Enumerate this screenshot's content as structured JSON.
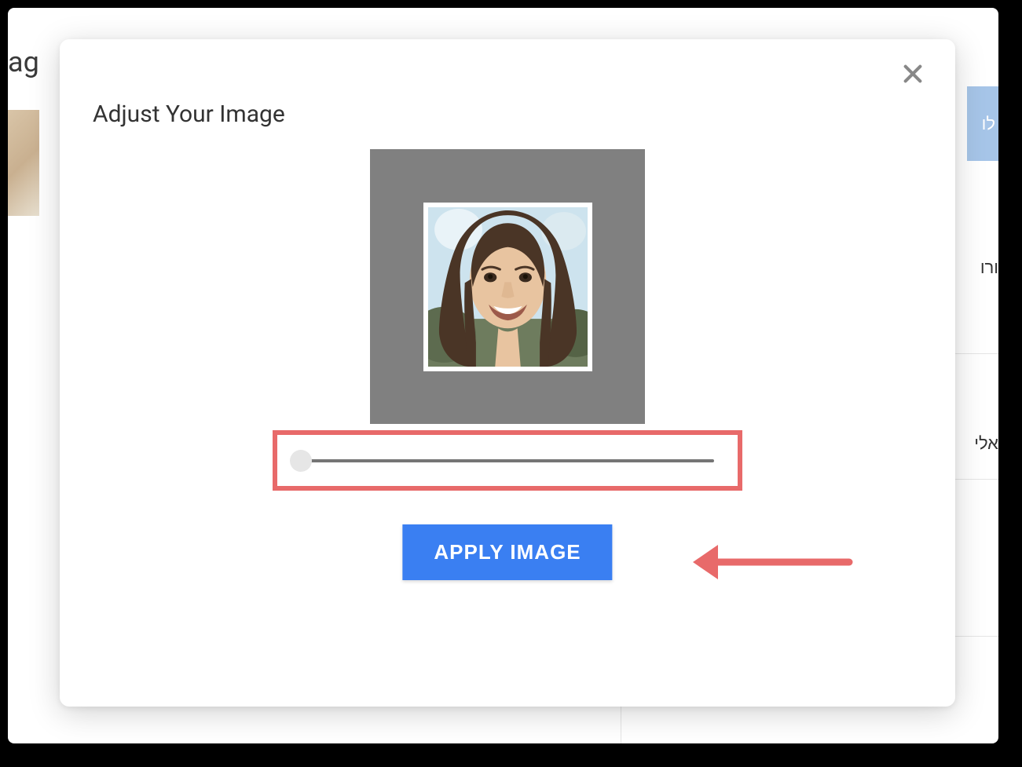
{
  "background": {
    "topleft_text": "ag",
    "topright_text": "לו",
    "right_text_1": "ורו",
    "right_text_2": "אלי"
  },
  "modal": {
    "title": "Adjust Your Image",
    "close_icon": "close",
    "apply_button_label": "APPLY IMAGE",
    "zoom_slider": {
      "value": 0,
      "min": 0,
      "max": 100
    }
  }
}
